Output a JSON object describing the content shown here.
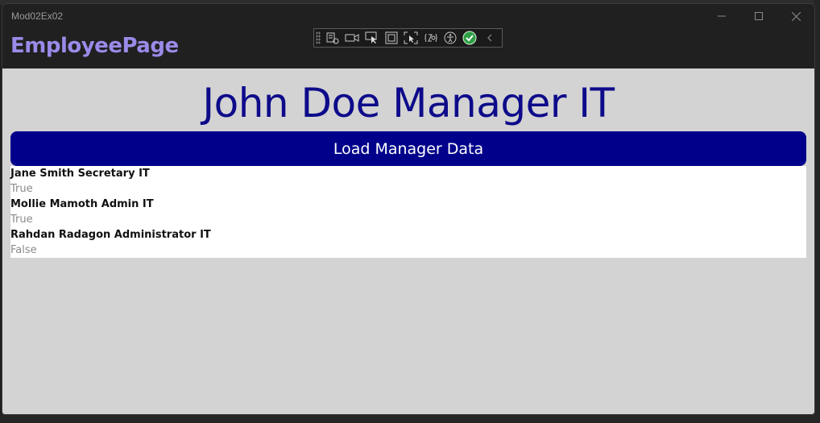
{
  "window": {
    "title": "Mod02Ex02"
  },
  "header": {
    "page_name": "EmployeePage"
  },
  "debug_toolbar": {
    "icons": [
      "live-visual-tree-icon",
      "record-icon",
      "select-element-icon",
      "display-layout-adorners-icon",
      "track-focus-icon",
      "hot-reload-icon",
      "accessibility-icon",
      "binding-check-icon",
      "collapse-icon"
    ]
  },
  "main": {
    "title": "John Doe Manager IT",
    "load_button_label": "Load Manager Data",
    "employees": [
      {
        "name": "Jane Smith Secretary IT",
        "status": "True"
      },
      {
        "name": "Mollie Mamoth Admin IT",
        "status": "True"
      },
      {
        "name": "Rahdan Radagon Administrator IT",
        "status": "False"
      }
    ]
  },
  "colors": {
    "page_name": "#9b8ae8",
    "title": "#0d0b8a",
    "button": "#00008b",
    "content_bg": "#d3d3d3"
  }
}
